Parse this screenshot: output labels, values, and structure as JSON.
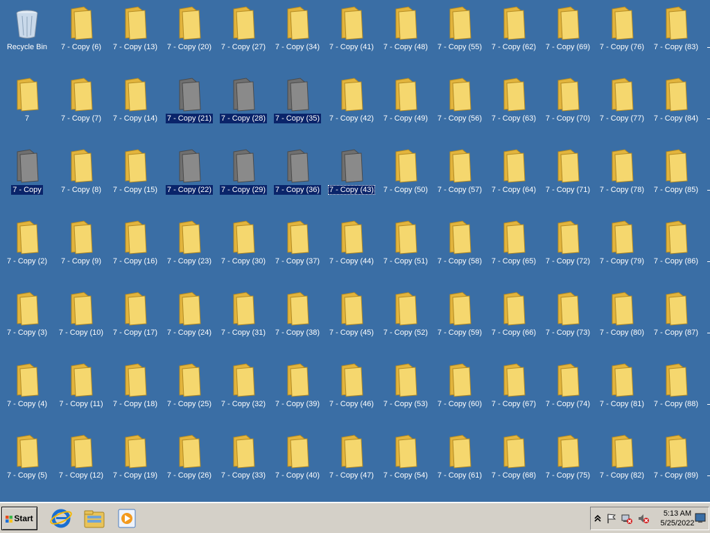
{
  "desktop": {
    "recycle_bin": "Recycle Bin",
    "items": [
      {
        "label": "Recycle Bin",
        "type": "bin"
      },
      {
        "label": "7 - Copy (6)"
      },
      {
        "label": "7 - Copy (13)"
      },
      {
        "label": "7 - Copy (20)"
      },
      {
        "label": "7 - Copy (27)"
      },
      {
        "label": "7 - Copy (34)"
      },
      {
        "label": "7 - Copy (41)"
      },
      {
        "label": "7 - Copy (48)"
      },
      {
        "label": "7 - Copy (55)"
      },
      {
        "label": "7 - Copy (62)"
      },
      {
        "label": "7 - Copy (69)"
      },
      {
        "label": "7 - Copy (76)"
      },
      {
        "label": "7 - Copy (83)"
      },
      {
        "label": "7"
      },
      {
        "label": "7 - Copy (7)"
      },
      {
        "label": "7 - Copy (14)"
      },
      {
        "label": "7 - Copy (21)",
        "selected": true
      },
      {
        "label": "7 - Copy (28)",
        "selected": true
      },
      {
        "label": "7 - Copy (35)",
        "selected": true
      },
      {
        "label": "7 - Copy (42)"
      },
      {
        "label": "7 - Copy (49)"
      },
      {
        "label": "7 - Copy (56)"
      },
      {
        "label": "7 - Copy (63)"
      },
      {
        "label": "7 - Copy (70)"
      },
      {
        "label": "7 - Copy (77)"
      },
      {
        "label": "7 - Copy (84)"
      },
      {
        "label": "7 - Copy",
        "selected": true
      },
      {
        "label": "7 - Copy (8)"
      },
      {
        "label": "7 - Copy (15)"
      },
      {
        "label": "7 - Copy (22)",
        "selected": true
      },
      {
        "label": "7 - Copy (29)",
        "selected": true
      },
      {
        "label": "7 - Copy (36)",
        "selected": true
      },
      {
        "label": "7 - Copy (43)",
        "selected": true,
        "focused": true
      },
      {
        "label": "7 - Copy (50)"
      },
      {
        "label": "7 - Copy (57)"
      },
      {
        "label": "7 - Copy (64)"
      },
      {
        "label": "7 - Copy (71)"
      },
      {
        "label": "7 - Copy (78)"
      },
      {
        "label": "7 - Copy (85)"
      },
      {
        "label": "7 - Copy (2)"
      },
      {
        "label": "7 - Copy (9)"
      },
      {
        "label": "7 - Copy (16)"
      },
      {
        "label": "7 - Copy (23)"
      },
      {
        "label": "7 - Copy (30)"
      },
      {
        "label": "7 - Copy (37)"
      },
      {
        "label": "7 - Copy (44)"
      },
      {
        "label": "7 - Copy (51)"
      },
      {
        "label": "7 - Copy (58)"
      },
      {
        "label": "7 - Copy (65)"
      },
      {
        "label": "7 - Copy (72)"
      },
      {
        "label": "7 - Copy (79)"
      },
      {
        "label": "7 - Copy (86)"
      },
      {
        "label": "7 - Copy (3)"
      },
      {
        "label": "7 - Copy (10)"
      },
      {
        "label": "7 - Copy (17)"
      },
      {
        "label": "7 - Copy (24)"
      },
      {
        "label": "7 - Copy (31)"
      },
      {
        "label": "7 - Copy (38)"
      },
      {
        "label": "7 - Copy (45)"
      },
      {
        "label": "7 - Copy (52)"
      },
      {
        "label": "7 - Copy (59)"
      },
      {
        "label": "7 - Copy (66)"
      },
      {
        "label": "7 - Copy (73)"
      },
      {
        "label": "7 - Copy (80)"
      },
      {
        "label": "7 - Copy (87)"
      },
      {
        "label": "7 - Copy (4)"
      },
      {
        "label": "7 - Copy (11)"
      },
      {
        "label": "7 - Copy (18)"
      },
      {
        "label": "7 - Copy (25)"
      },
      {
        "label": "7 - Copy (32)"
      },
      {
        "label": "7 - Copy (39)"
      },
      {
        "label": "7 - Copy (46)"
      },
      {
        "label": "7 - Copy (53)"
      },
      {
        "label": "7 - Copy (60)"
      },
      {
        "label": "7 - Copy (67)"
      },
      {
        "label": "7 - Copy (74)"
      },
      {
        "label": "7 - Copy (81)"
      },
      {
        "label": "7 - Copy (88)"
      },
      {
        "label": "7 - Copy (5)"
      },
      {
        "label": "7 - Copy (12)"
      },
      {
        "label": "7 - Copy (19)"
      },
      {
        "label": "7 - Copy (26)"
      },
      {
        "label": "7 - Copy (33)"
      },
      {
        "label": "7 - Copy (40)"
      },
      {
        "label": "7 - Copy (47)"
      },
      {
        "label": "7 - Copy (54)"
      },
      {
        "label": "7 - Copy (61)"
      },
      {
        "label": "7 - Copy (68)"
      },
      {
        "label": "7 - Copy (75)"
      },
      {
        "label": "7 - Copy (82)"
      },
      {
        "label": "7 - Copy (89)"
      }
    ]
  },
  "taskbar": {
    "start_label": "Start",
    "quick_launch": [
      "internet-explorer-icon",
      "windows-explorer-icon",
      "media-player-icon"
    ],
    "tray_icons": [
      "show-hidden-icons-chevron-icon",
      "action-center-flag-icon",
      "network-disconnected-icon",
      "volume-muted-icon"
    ],
    "clock_time": "5:13 AM",
    "clock_date": "5/25/2022"
  },
  "colors": {
    "desktop_background": "#3a6ea5",
    "selection_highlight": "#0a246a",
    "folder_yellow": "#f5d76e",
    "folder_selected_gray": "#8a8a8a",
    "taskbar": "#d4d0c8"
  }
}
